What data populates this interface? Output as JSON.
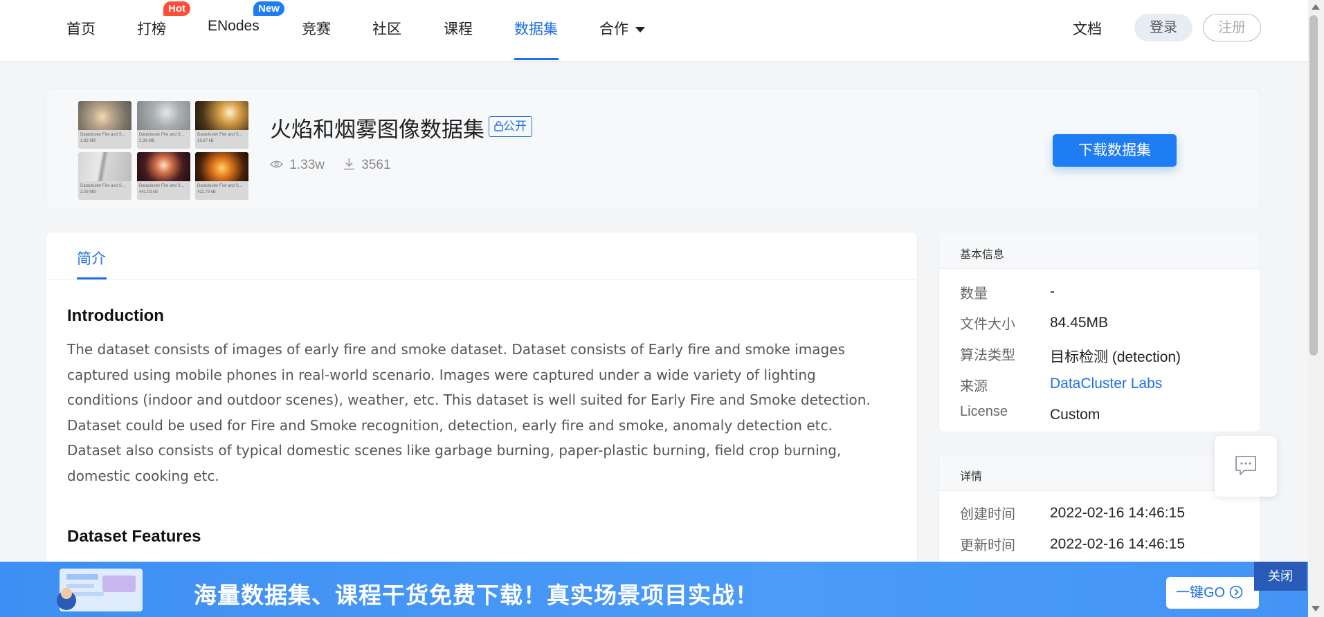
{
  "nav": {
    "items": [
      {
        "label": "首页"
      },
      {
        "label": "打榜",
        "badge": "Hot"
      },
      {
        "label": "ENodes",
        "badge": "New"
      },
      {
        "label": "竞赛"
      },
      {
        "label": "社区"
      },
      {
        "label": "课程"
      },
      {
        "label": "数据集",
        "active": true
      },
      {
        "label": "合作"
      }
    ],
    "doc": "文档",
    "login": "登录",
    "register": "注册"
  },
  "dataset": {
    "title": "火焰和烟雾图像数据集",
    "visibility": "公开",
    "views": "1.33w",
    "downloads": "3561",
    "download_button": "下载数据集",
    "thumbnails": [
      {
        "caption": "Datacluster Fire and S...",
        "size": "1.82 MB"
      },
      {
        "caption": "Datacluster Fire and S...",
        "size": "2.39 MB"
      },
      {
        "caption": "Datacluster Fire and S...",
        "size": "16.67 kB"
      },
      {
        "caption": "Datacluster Fire and S...",
        "size": "2.59 MB"
      },
      {
        "caption": "Datacluster Fire and S...",
        "size": "441.03 kB"
      },
      {
        "caption": "Datacluster Fire and S...",
        "size": "411.79 kB"
      }
    ]
  },
  "tabs": {
    "intro": "简介"
  },
  "content": {
    "intro_heading": "Introduction",
    "intro_lines": [
      "The dataset consists of images of early fire and smoke dataset. Dataset consists of Early fire and smoke images",
      "captured using mobile phones in real-world scenario. Images were captured under a wide variety of lighting",
      "conditions (indoor and outdoor scenes), weather, etc. This dataset is well suited for Early Fire and Smoke detection.",
      "Dataset could be used for Fire and Smoke recognition, detection, early fire and smoke, anomaly detection etc.",
      "Dataset also consists of typical domestic scenes like garbage burning, paper-plastic burning, field crop burning,",
      "domestic cooking etc."
    ],
    "features_heading": "Dataset Features"
  },
  "basic_info": {
    "title": "基本信息",
    "rows": [
      {
        "key": "数量",
        "value": "-"
      },
      {
        "key": "文件大小",
        "value": "84.45MB"
      },
      {
        "key": "算法类型",
        "value": "目标检测 (detection)"
      },
      {
        "key": "来源",
        "value": "DataCluster Labs"
      },
      {
        "key": "License",
        "value": "Custom"
      }
    ]
  },
  "details": {
    "title": "详情",
    "rows": [
      {
        "key": "创建时间",
        "value": "2022-02-16 14:46:15"
      },
      {
        "key": "更新时间",
        "value": "2022-02-16 14:46:15"
      }
    ]
  },
  "banner": {
    "text": "海量数据集、课程干货免费下载！真实场景项目实战！",
    "go_button": "一键GO",
    "close": "关闭"
  },
  "colors": {
    "accent": "#1e6fe8",
    "hot": "#ff4d3a",
    "new": "#1e7cf5",
    "banner": "#4394f6"
  }
}
